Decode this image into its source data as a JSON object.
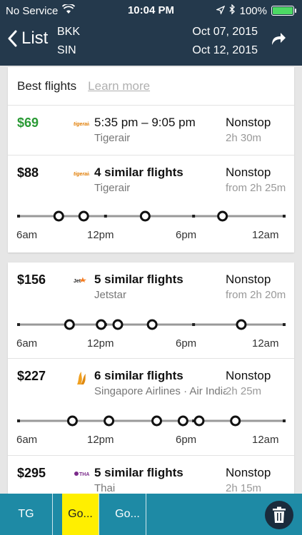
{
  "status": {
    "carrier": "No Service",
    "time": "10:04 PM",
    "battery": "100%"
  },
  "nav": {
    "back_label": "List",
    "origin": "BKK",
    "destination": "SIN",
    "depart_date": "Oct 07, 2015",
    "return_date": "Oct 12, 2015"
  },
  "best": {
    "title": "Best flights",
    "learn_more": "Learn more"
  },
  "timeline_labels": [
    "6am",
    "12pm",
    "6pm",
    "12am"
  ],
  "flights": [
    {
      "price": "$69",
      "main": "5:35 pm – 9:05 pm",
      "airline": "Tigerair",
      "stops": "Nonstop",
      "duration": "2h 30m",
      "logo": "tigerair",
      "dots": []
    },
    {
      "price": "$88",
      "main": "4 similar flights",
      "airline": "Tigerair",
      "stops": "Nonstop",
      "duration": "from 2h 25m",
      "logo": "tigerair",
      "dots": [
        0.155,
        0.248,
        0.477,
        0.765
      ]
    },
    {
      "price": "$156",
      "main": "5 similar flights",
      "airline": "Jetstar",
      "stops": "Nonstop",
      "duration": "from 2h 20m",
      "logo": "jetstar",
      "dots": [
        0.195,
        0.313,
        0.375,
        0.503,
        0.835
      ]
    },
    {
      "price": "$227",
      "main": "6 similar flights",
      "airline": "Singapore Airlines · Air India",
      "stops": "Nonstop",
      "duration": "2h 25m",
      "logo": "singapore",
      "dots": [
        0.206,
        0.342,
        0.52,
        0.618,
        0.678,
        0.813
      ]
    },
    {
      "price": "$295",
      "main": "5 similar flights",
      "airline": "Thai",
      "stops": "Nonstop",
      "duration": "2h 15m",
      "logo": "thai",
      "dots": []
    }
  ],
  "bottom_tabs": [
    "TG",
    "Go...",
    "Go..."
  ]
}
